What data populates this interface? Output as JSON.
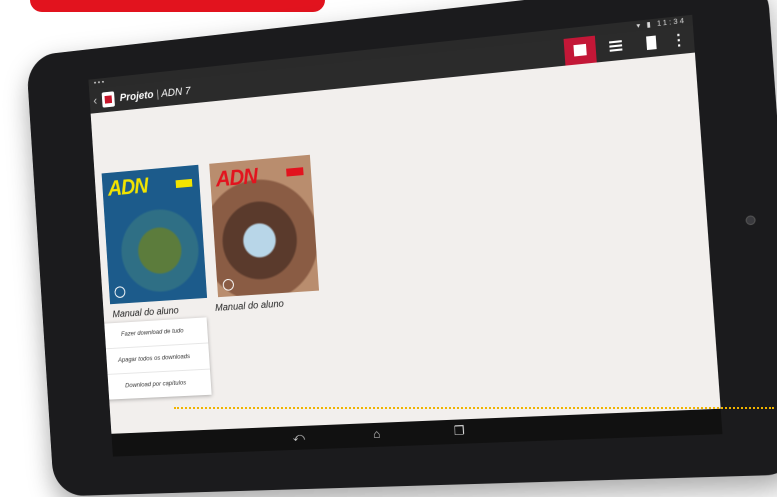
{
  "app": {
    "title_bold": "Projeto",
    "title_sep": " | ",
    "title_rest": "ADN 7"
  },
  "statusbar": {
    "left": "▪▪▪",
    "right": "▾ ▮ 11:34"
  },
  "books": [
    {
      "logo": "ADN",
      "caption": "Manual do aluno"
    },
    {
      "logo": "ADN",
      "caption": "Manual do aluno"
    }
  ],
  "context_menu": {
    "items": [
      "Fazer download de tudo",
      "Apagar todos os downloads",
      "Download por capítulos"
    ]
  },
  "navbar": {
    "back": "⤺",
    "home": "⌂",
    "recent": "❐"
  },
  "toolbar": {
    "more": "⋮"
  },
  "colors": {
    "accent_red": "#e2131e",
    "action_active": "#c31737",
    "leader": "#f0b400"
  }
}
